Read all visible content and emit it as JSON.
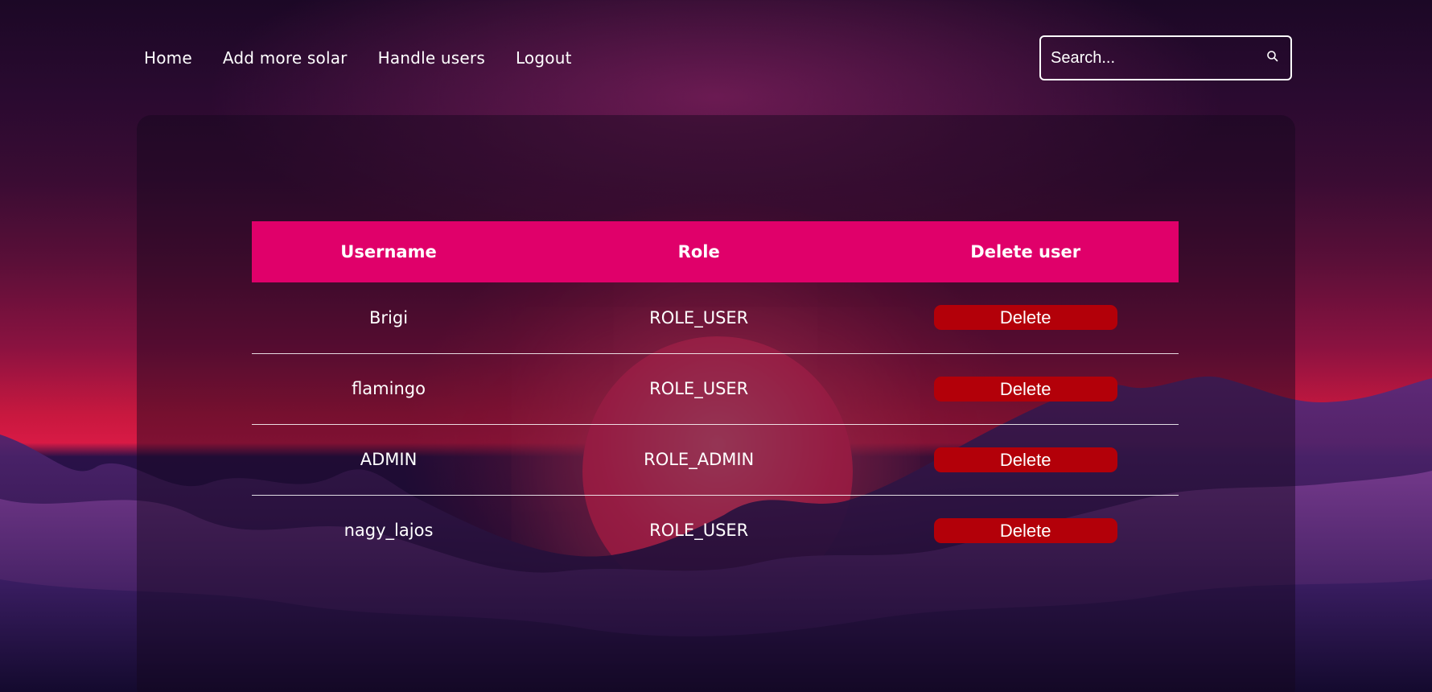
{
  "nav": {
    "items": [
      {
        "label": "Home"
      },
      {
        "label": "Add more solar"
      },
      {
        "label": "Handle users"
      },
      {
        "label": "Logout"
      }
    ]
  },
  "search": {
    "placeholder": "Search...",
    "icon": "search-icon"
  },
  "table": {
    "headers": [
      "Username",
      "Role",
      "Delete user"
    ],
    "rows": [
      {
        "username": "Brigi",
        "role": "ROLE_USER",
        "action": "Delete"
      },
      {
        "username": "flamingo",
        "role": "ROLE_USER",
        "action": "Delete"
      },
      {
        "username": "ADMIN",
        "role": "ROLE_ADMIN",
        "action": "Delete"
      },
      {
        "username": "nagy_lajos",
        "role": "ROLE_USER",
        "action": "Delete"
      }
    ]
  },
  "colors": {
    "header_bg": "#e0006a",
    "delete_bg": "#b30009",
    "sun": "#ff2f63"
  }
}
